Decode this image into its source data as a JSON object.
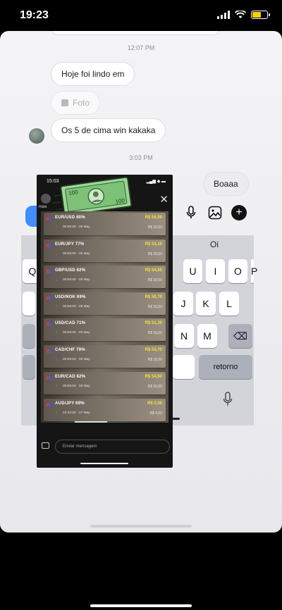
{
  "status_bar": {
    "time": "19:23"
  },
  "chat": {
    "timestamp_1": "12:07 PM",
    "msg_1": "Hoje foi lindo em",
    "photo_label": "Foto",
    "msg_2": "Os 5 de cima win kakaka",
    "timestamp_2": "3:03 PM",
    "sent_msg": "Boaaa"
  },
  "keyboard": {
    "suggestion": "Oi",
    "keys": {
      "q": "Q",
      "u": "U",
      "i": "I",
      "o": "O",
      "p": "P",
      "j": "J",
      "k": "K",
      "l": "L",
      "n": "N",
      "m": "M",
      "return": "retorno",
      "backspace": "⌫"
    }
  },
  "overlay": {
    "status_time": "15:03",
    "username": "Histó",
    "message_placeholder": "Enviar mensagem",
    "trades": [
      {
        "pair": "EUR/USD 80%",
        "direction": "down",
        "time": "00:05:00 · 09 May",
        "profit": "R$ 54,00",
        "amount": "R$ 30,00"
      },
      {
        "pair": "EUR/JPY 77%",
        "direction": "down",
        "time": "00:05:00 · 09 May",
        "profit": "R$ 53,10",
        "amount": "R$ 30,00"
      },
      {
        "pair": "GBP/USD 82%",
        "direction": "down",
        "time": "00:05:00 · 09 May",
        "profit": "R$ 54,60",
        "amount": "R$ 30,00"
      },
      {
        "pair": "USD/NOK 69%",
        "direction": "up",
        "time": "00:05:00 · 09 May",
        "profit": "R$ 50,70",
        "amount": "R$ 30,00"
      },
      {
        "pair": "USD/CAD 71%",
        "direction": "up",
        "time": "00:05:00 · 09 May",
        "profit": "R$ 51,30",
        "amount": "R$ 30,00"
      },
      {
        "pair": "CAD/CHF 79%",
        "direction": "down",
        "time": "00:05:00 · 08 May",
        "profit": "R$ 53,70",
        "amount": "R$ 30,00"
      },
      {
        "pair": "EUR/CAD 82%",
        "direction": "up",
        "time": "00:05:00 · 08 May",
        "profit": "R$ 54,60",
        "amount": "R$ 30,00"
      },
      {
        "pair": "AUD/JPY 69%",
        "direction": "up",
        "time": "22:42:00 · 07 May",
        "profit": "R$ 0,00",
        "amount": "R$ 4,00"
      }
    ]
  },
  "colors": {
    "accent_blue": "#3f8dff",
    "profit_yellow": "#f4e23b",
    "up_green": "#2dd86b",
    "down_red": "#ef4f4f"
  }
}
